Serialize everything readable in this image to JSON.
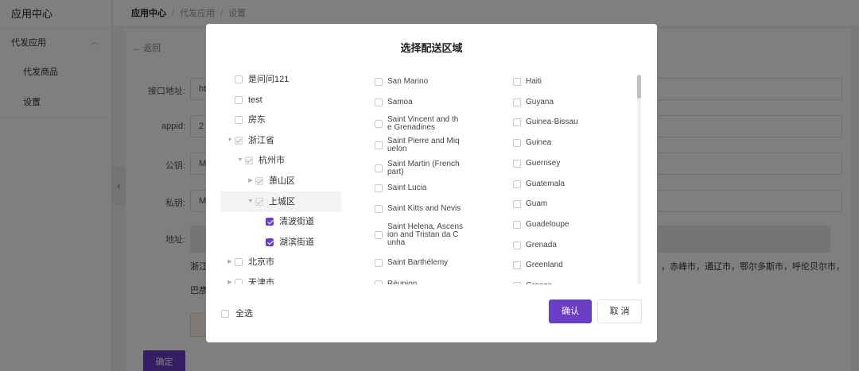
{
  "sidebar": {
    "title": "应用中心",
    "group": "代发应用",
    "items": [
      "代发商品",
      "设置"
    ]
  },
  "breadcrumb": [
    "应用中心",
    "代发应用",
    "设置"
  ],
  "page": {
    "back_label": "返回",
    "fields": [
      {
        "label": "接口地址:",
        "value": "ht"
      },
      {
        "label": "appid:",
        "value": "2"
      },
      {
        "label": "公钥:",
        "value": "M"
      },
      {
        "label": "私钥:",
        "value": "M"
      }
    ],
    "address_label": "地址:",
    "address_line1_left": "浙江",
    "address_line1_right": "，赤峰市，通辽市，鄂尔多斯市，呼伦贝尔市，",
    "address_line2": "巴彦",
    "confirm_label": "确定"
  },
  "modal": {
    "title": "选择配送区域",
    "tree": [
      {
        "label": "是问问121",
        "level": 0,
        "arrow": "",
        "state": "off"
      },
      {
        "label": "test",
        "level": 0,
        "arrow": "",
        "state": "off"
      },
      {
        "label": "房东",
        "level": 0,
        "arrow": "",
        "state": "off"
      },
      {
        "label": "浙江省",
        "level": 0,
        "arrow": "down",
        "state": "dis"
      },
      {
        "label": "杭州市",
        "level": 1,
        "arrow": "down",
        "state": "dis"
      },
      {
        "label": "萧山区",
        "level": 2,
        "arrow": "right",
        "state": "dis"
      },
      {
        "label": "上城区",
        "level": 2,
        "arrow": "down",
        "state": "dis",
        "highlight": true
      },
      {
        "label": "清波街道",
        "level": 3,
        "arrow": "",
        "state": "on"
      },
      {
        "label": "湖滨街道",
        "level": 3,
        "arrow": "",
        "state": "on"
      },
      {
        "label": "北京市",
        "level": 0,
        "arrow": "right",
        "state": "off"
      },
      {
        "label": "天津市",
        "level": 0,
        "arrow": "right",
        "state": "off"
      }
    ],
    "col2": [
      [
        "San Marino"
      ],
      [
        "Samoa"
      ],
      [
        "Saint Vincent and th",
        "e Grenadines"
      ],
      [
        "Saint Pierre and Miq",
        "uelon"
      ],
      [
        "Saint Martin (French",
        "part)"
      ],
      [
        "Saint Lucia"
      ],
      [
        "Saint Kitts and Nevis"
      ],
      [
        "Saint Helena, Ascens",
        "ion and Tristan da C",
        "unha"
      ],
      [
        "Saint Barthélemy"
      ],
      [
        "Réunion"
      ]
    ],
    "col3": [
      "Haiti",
      "Guyana",
      "Guinea-Bissau",
      "Guinea",
      "Guernsey",
      "Guatemala",
      "Guam",
      "Guadeloupe",
      "Grenada",
      "Greenland",
      "Greece"
    ],
    "select_all_label": "全选",
    "ok_label": "确认",
    "cancel_label": "取 消"
  },
  "colors": {
    "accent": "#6b3fc4",
    "overlay": "rgba(0,0,0,0.5)"
  },
  "icons": {
    "back": "arrow-left-icon",
    "collapse": "chevron-left-icon",
    "group": "chevron-up-icon"
  }
}
